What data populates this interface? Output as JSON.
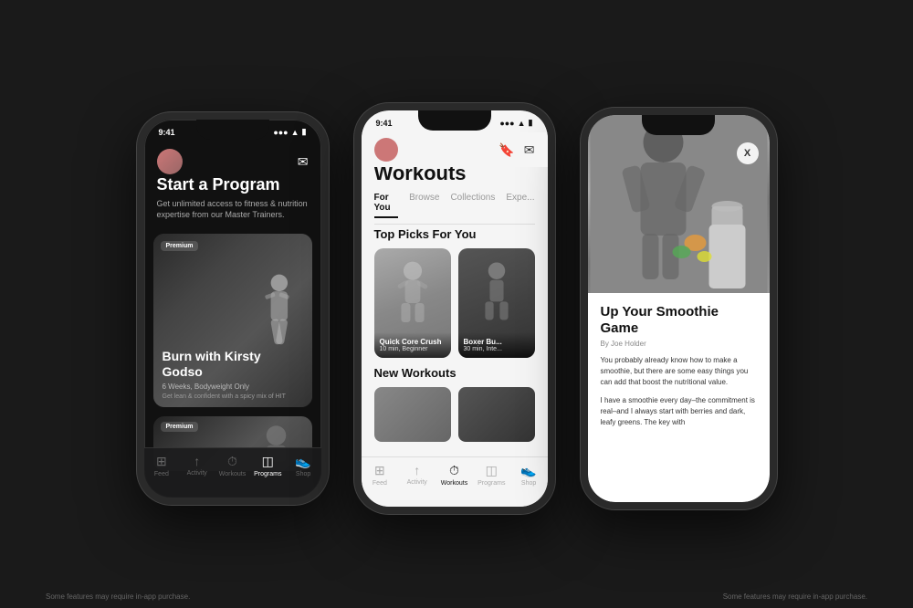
{
  "background_color": "#1a1a1a",
  "phones": [
    {
      "id": "phone1",
      "theme": "dark",
      "status_bar": {
        "time": "9:41",
        "signal": "●●●",
        "wifi": "▲",
        "battery": "▮"
      },
      "header": {
        "avatar_label": "user avatar",
        "mail_icon": "✉"
      },
      "title": "Start a Program",
      "subtitle": "Get unlimited access to fitness & nutrition expertise from our Master Trainers.",
      "hero_card": {
        "badge": "Premium",
        "workout_name": "Burn with Kirsty Godso",
        "duration": "6 Weeks, Bodyweight Only",
        "description": "Get lean & confident with a spicy mix of HIT"
      },
      "second_card": {
        "badge": "Premium"
      },
      "nav": [
        {
          "icon": "⊞",
          "label": "Feed",
          "active": false
        },
        {
          "icon": "↑",
          "label": "Activity",
          "active": false
        },
        {
          "icon": "⏱",
          "label": "Workouts",
          "active": false
        },
        {
          "icon": "◫",
          "label": "Programs",
          "active": true
        },
        {
          "icon": "👟",
          "label": "Shop",
          "active": false
        }
      ]
    },
    {
      "id": "phone2",
      "theme": "light",
      "status_bar": {
        "time": "9:41",
        "signal": "●●●",
        "wifi": "▲",
        "battery": "▮"
      },
      "title": "Workouts",
      "tabs": [
        {
          "label": "For You",
          "active": true
        },
        {
          "label": "Browse",
          "active": false
        },
        {
          "label": "Collections",
          "active": false
        },
        {
          "label": "Expe...",
          "active": false
        }
      ],
      "section1": {
        "heading": "Top Picks For You",
        "cards": [
          {
            "name": "Quick Core Crush",
            "detail": "10 min, Beginner"
          },
          {
            "name": "Boxer Bu...",
            "detail": "30 min, Inte..."
          }
        ]
      },
      "section2": {
        "heading": "New Workouts",
        "cards": [
          {
            "name": ""
          },
          {
            "name": ""
          }
        ]
      },
      "nav": [
        {
          "icon": "⊞",
          "label": "Feed",
          "active": false
        },
        {
          "icon": "↑",
          "label": "Activity",
          "active": false
        },
        {
          "icon": "⏱",
          "label": "Workouts",
          "active": true
        },
        {
          "icon": "◫",
          "label": "Programs",
          "active": false
        },
        {
          "icon": "👟",
          "label": "Shop",
          "active": false
        }
      ]
    },
    {
      "id": "phone3",
      "theme": "light-article",
      "close_btn": "X",
      "article": {
        "title": "Up Your Smoothie Game",
        "byline": "By Joe Holder",
        "body_1": "You probably already know how to make a smoothie, but there are some easy things you can add that boost the nutritional value.",
        "body_2": "I have a smoothie every day–the commitment is real–and I always start with berries and dark, leafy greens. The key with"
      }
    }
  ],
  "footer": {
    "left_note": "Some features may require in-app purchase.",
    "right_note": "Some features may require in-app purchase."
  }
}
